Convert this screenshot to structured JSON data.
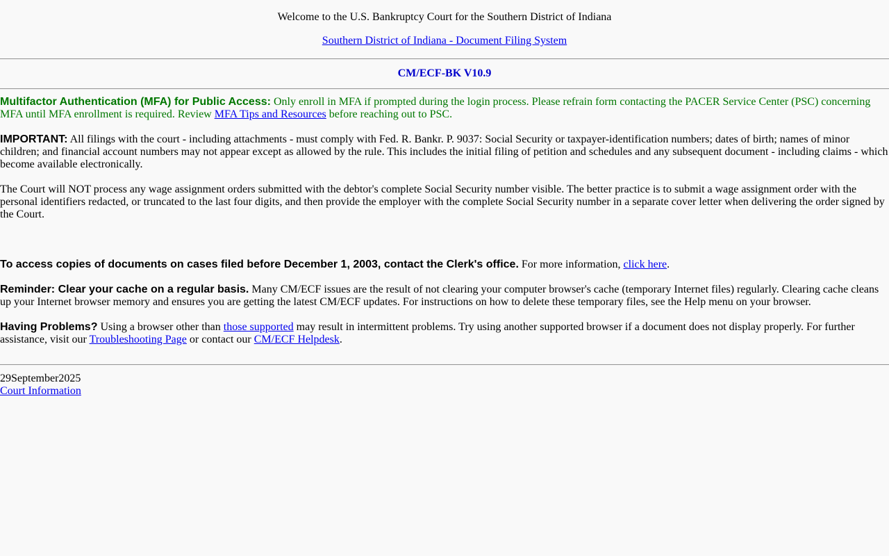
{
  "header": {
    "welcome": "Welcome to the U.S. Bankruptcy Court for the Southern District of Indiana",
    "filing_system_link": "Southern District of Indiana - Document Filing System",
    "version": "CM/ECF-BK V10.9"
  },
  "mfa": {
    "heading": "Multifactor Authentication (MFA) for Public Access:",
    "text_before": " Only enroll in MFA if prompted during the login process. Please refrain form contacting the PACER Service Center (PSC) concerning MFA until MFA enrollment is required. Review ",
    "link": "MFA Tips and Resources",
    "text_after": " before reaching out to PSC."
  },
  "important": {
    "heading": "IMPORTANT:",
    "text": " All filings with the court - including attachments - must comply with Fed. R. Bankr. P. 9037: Social Security or taxpayer-identification numbers; dates of birth; names of minor children; and financial account numbers may not appear except as allowed by the rule. This includes the initial filing of petition and schedules and any subsequent document - including claims - which become available electronically."
  },
  "wage": {
    "text": "The Court will NOT process any wage assignment orders submitted with the debtor's complete Social Security number visible. The better practice is to submit a wage assignment order with the personal identifiers redacted, or truncated to the last four digits, and then provide the employer with the complete Social Security number in a separate cover letter when delivering the order signed by the Court."
  },
  "access": {
    "heading": "To access copies of documents on cases filed before December 1, 2003, contact the Clerk's office.",
    "text_before": " For more information, ",
    "link": "click here",
    "text_after": "."
  },
  "reminder": {
    "heading": "Reminder: Clear your cache on a regular basis.",
    "text": " Many CM/ECF issues are the result of not clearing your computer browser's cache (temporary Internet files) regularly. Clearing cache cleans up your Internet browser memory and ensures you are getting the latest CM/ECF updates. For instructions on how to delete these temporary files, see the Help menu on your browser."
  },
  "problems": {
    "heading": "Having Problems?",
    "text_1": " Using a browser other than ",
    "link_supported": "those supported",
    "text_2": " may result in intermittent problems. Try using another supported browser if a document does not display properly. For further assistance, visit our ",
    "link_troubleshooting": "Troubleshooting Page",
    "text_3": " or contact our ",
    "link_helpdesk": "CM/ECF Helpdesk",
    "text_4": "."
  },
  "footer": {
    "date": "29September2025",
    "court_info_link": "Court Information"
  },
  "colors": {
    "mfa_green": "#007700",
    "version_blue": "#0000cc",
    "link_blue": "#0000ee",
    "background": "#f9f9f9"
  }
}
